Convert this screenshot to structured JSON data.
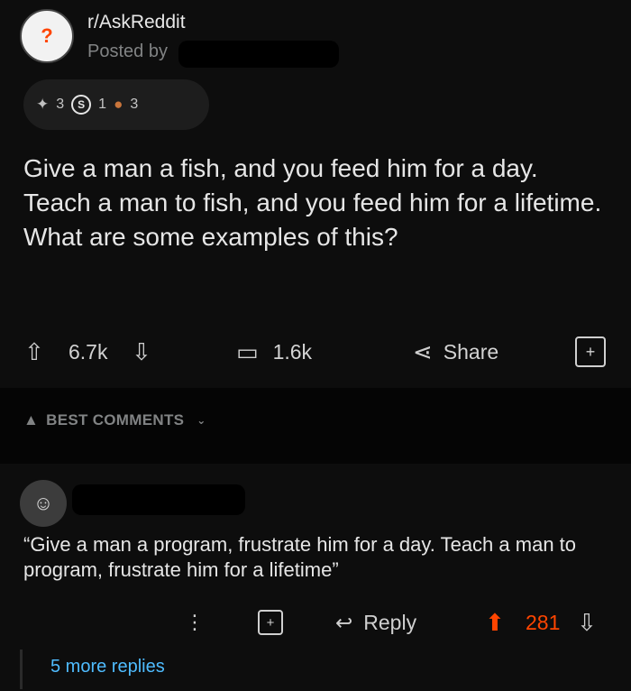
{
  "post": {
    "subreddit": "r/AskReddit",
    "posted_by": "Posted by",
    "awards": [
      {
        "icon": "silver-award-icon",
        "count": "3"
      },
      {
        "icon": "s-award-icon",
        "label": "S",
        "count": "1"
      },
      {
        "icon": "bronze-award-icon",
        "count": "3"
      }
    ],
    "title": "Give a man a fish, and you feed him for a day. Teach a man to fish, and you feed him for a lifetime. What are some examples of this?",
    "score": "6.7k",
    "comments": "1.6k",
    "share_label": "Share",
    "gift_glyph": "+"
  },
  "sort": {
    "label": "BEST COMMENTS"
  },
  "comment": {
    "text": "“Give a man a program, frustrate him for a day. Teach a man to program, frustrate him for a lifetime”",
    "reply_label": "Reply",
    "score": "281",
    "more_replies": "5 more replies"
  },
  "colors": {
    "upvote_active": "#ff4500",
    "link": "#4fbcff",
    "muted": "#818384"
  }
}
